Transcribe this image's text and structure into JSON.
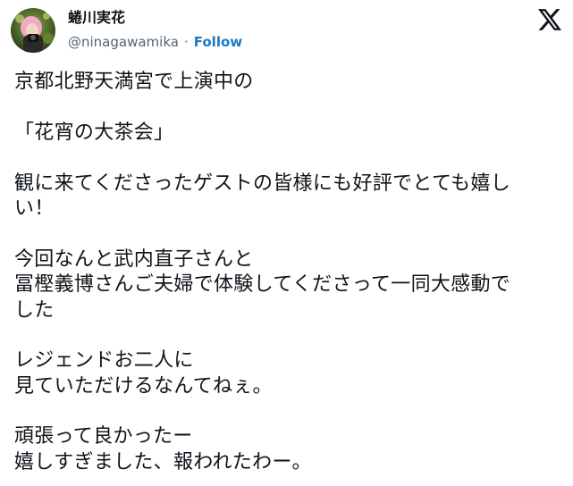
{
  "author": {
    "display_name": "蜷川実花",
    "handle": "@ninagawamika",
    "separator": "·",
    "follow_label": "Follow",
    "avatar_icon": "profile-avatar",
    "platform_icon": "x-logo-icon"
  },
  "post": {
    "lines": [
      "京都北野天満宮で上演中の",
      "",
      "「花宵の大茶会」",
      "",
      "観に来てくださったゲストの皆様にも好評でとても嬉し",
      "い！",
      "",
      "今回なんと武内直子さんと",
      "冨樫義博さんご夫婦で体験してくださって一同大感動で",
      "した",
      "",
      "レジェンドお二人に",
      "見ていただけるなんてねぇ。",
      "",
      "頑張って良かったー",
      "嬉しすぎました、報われたわー。"
    ]
  },
  "colors": {
    "text": "#0f1419",
    "secondary": "#536471",
    "follow": "#1d79c4",
    "background": "#ffffff"
  }
}
